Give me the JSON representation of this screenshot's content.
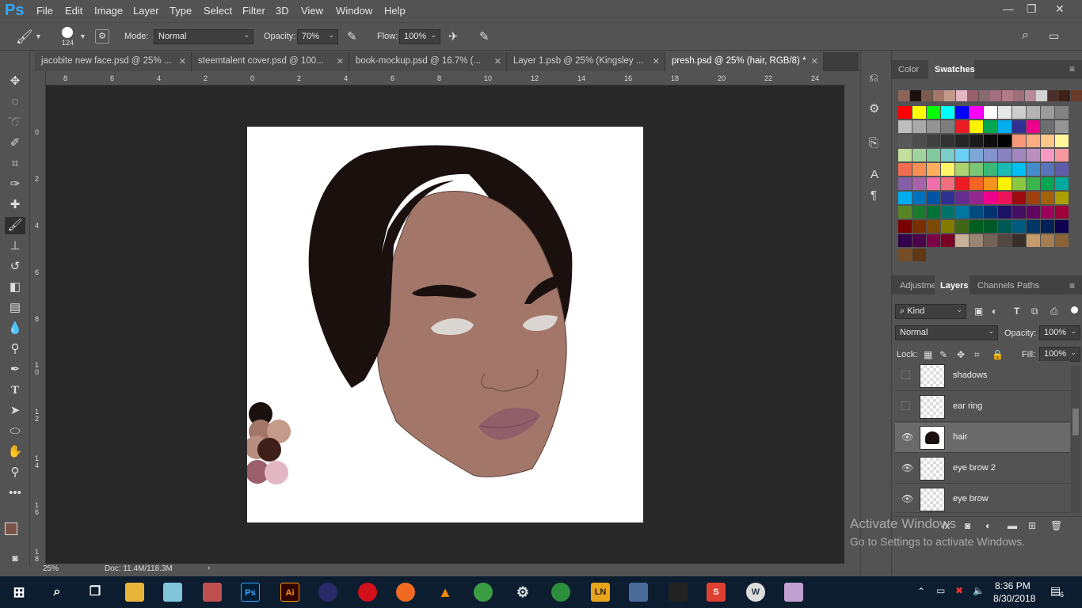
{
  "app": {
    "logo": "Ps"
  },
  "menu": [
    "File",
    "Edit",
    "Image",
    "Layer",
    "Type",
    "Select",
    "Filter",
    "3D",
    "View",
    "Window",
    "Help"
  ],
  "window_controls": {
    "minimize": "—",
    "restore": "❐",
    "close": "✕"
  },
  "options": {
    "brush_size": "124",
    "mode_label": "Mode:",
    "mode_value": "Normal",
    "opacity_label": "Opacity:",
    "opacity_value": "70%",
    "flow_label": "Flow:",
    "flow_value": "100%"
  },
  "tabs": [
    {
      "label": "jacobite new face.psd @ 25% ...",
      "close": "✕"
    },
    {
      "label": "steemtalent cover.psd @ 100...",
      "close": "✕"
    },
    {
      "label": "book-mockup.psd @ 16.7% (...",
      "close": "✕"
    },
    {
      "label": "Layer 1.psb @ 25% (Kingsley ...",
      "close": "✕"
    },
    {
      "label": "presh.psd @ 25% (hair, RGB/8) *",
      "close": "✕"
    }
  ],
  "ruler_top": [
    "8",
    "6",
    "4",
    "2",
    "0",
    "2",
    "4",
    "6",
    "8",
    "10",
    "12",
    "14",
    "16",
    "18",
    "20",
    "22",
    "24"
  ],
  "ruler_left": [
    "0",
    "2",
    "4",
    "6",
    "8",
    "1 0",
    "1 2",
    "1 4",
    "1 6",
    "1 8"
  ],
  "status": {
    "zoom": "25%",
    "doc": "Doc: 11.4M/118.3M",
    "arrow": "›"
  },
  "color_panel": {
    "tab_color": "Color",
    "tab_swatches": "Swatches"
  },
  "layers_panel": {
    "tabs": [
      "Adjustme",
      "Layers",
      "Channels",
      "Paths"
    ],
    "kind": "Kind",
    "blend": "Normal",
    "opacity_label": "Opacity:",
    "opacity_value": "100%",
    "lock_label": "Lock:",
    "fill_label": "Fill:",
    "fill_value": "100%",
    "layers": [
      {
        "name": "shadows",
        "visible": false
      },
      {
        "name": "ear ring",
        "visible": false
      },
      {
        "name": "hair",
        "visible": true,
        "active": true
      },
      {
        "name": "eye brow 2",
        "visible": true
      },
      {
        "name": "eye brow",
        "visible": true
      }
    ],
    "footer_icons": [
      "fx",
      "◙",
      "◐",
      "▬",
      "⊞",
      "🗑"
    ]
  },
  "watermark": {
    "line1": "Activate Windows",
    "line2": "Go to Settings to activate Windows."
  },
  "taskbar": {
    "time": "8:36 PM",
    "date": "8/30/2018",
    "notif": "6"
  },
  "colors": {
    "skin": "#a27769",
    "hair": "#1a110f",
    "lips": "#8f5f6a",
    "eyes": "#dcd6d2"
  }
}
